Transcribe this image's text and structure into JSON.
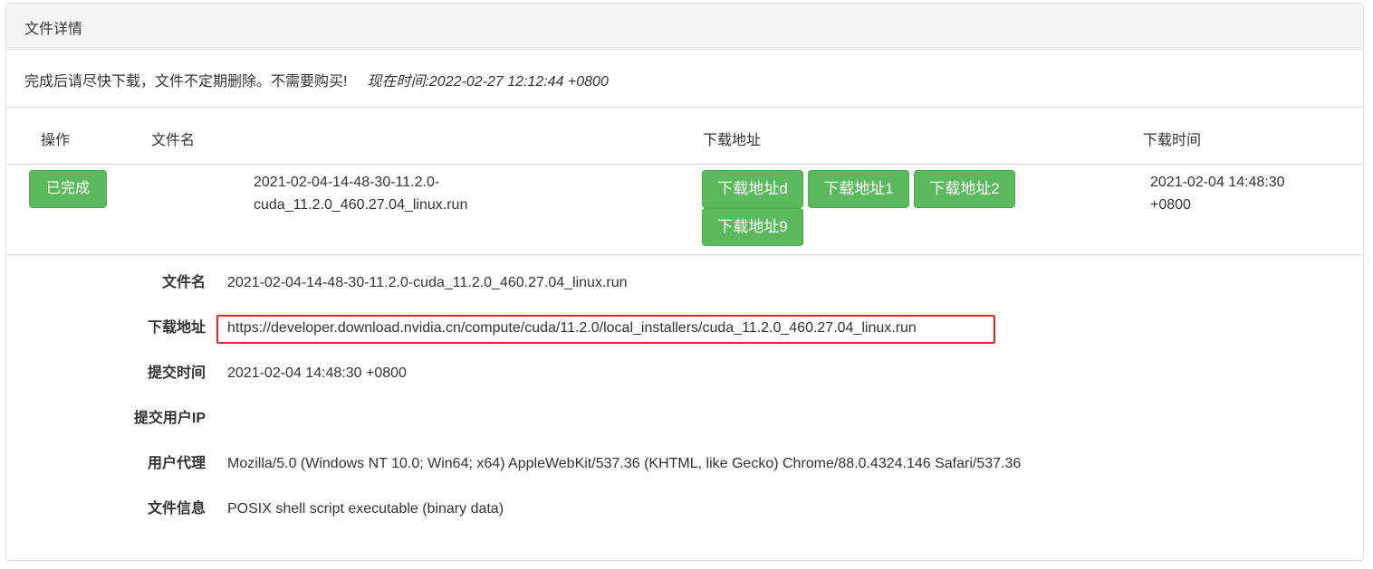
{
  "panel": {
    "title": "文件详情"
  },
  "notice": {
    "message": "完成后请尽快下载，文件不定期删除。不需要购买!",
    "current_time": "现在时间:2022-02-27 12:12:44 +0800"
  },
  "table": {
    "headers": {
      "action": "操作",
      "filename": "文件名",
      "download_url": "下载地址",
      "download_time": "下载时间"
    },
    "row": {
      "status_button": "已完成",
      "filename_line1": "2021-02-04-14-48-30-11.2.0-",
      "filename_line2": "cuda_11.2.0_460.27.04_linux.run",
      "download_buttons": [
        "下载地址d",
        "下载地址1",
        "下载地址2",
        "下载地址9"
      ],
      "time_line1": "2021-02-04 14:48:30",
      "time_line2": "+0800"
    }
  },
  "details": {
    "filename_label": "文件名",
    "filename_value": "2021-02-04-14-48-30-11.2.0-cuda_11.2.0_460.27.04_linux.run",
    "url_label": "下载地址",
    "url_value": "https://developer.download.nvidia.cn/compute/cuda/11.2.0/local_installers/cuda_11.2.0_460.27.04_linux.run",
    "submit_time_label": "提交时间",
    "submit_time_value": "2021-02-04 14:48:30 +0800",
    "submit_ip_label": "提交用户IP",
    "submit_ip_value": "",
    "user_agent_label": "用户代理",
    "user_agent_value": "Mozilla/5.0 (Windows NT 10.0; Win64; x64) AppleWebKit/537.36 (KHTML, like Gecko) Chrome/88.0.4324.146 Safari/537.36",
    "file_info_label": "文件信息",
    "file_info_value": "POSIX shell script executable (binary data)"
  },
  "colors": {
    "button_green": "#5cb85c",
    "highlight_red": "#e5262b",
    "heading_bg": "#f5f5f5"
  }
}
